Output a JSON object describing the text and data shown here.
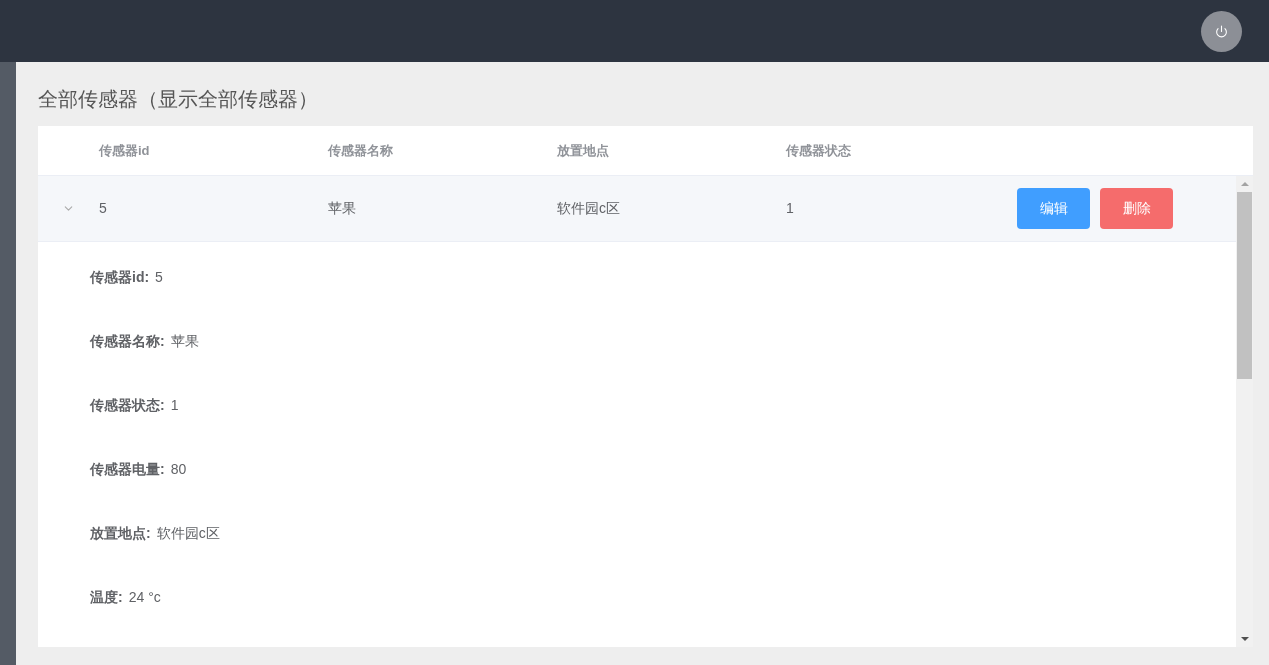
{
  "page_title": "全部传感器（显示全部传感器）",
  "table": {
    "columns": [
      "传感器id",
      "传感器名称",
      "放置地点",
      "传感器状态"
    ],
    "rows": [
      {
        "expanded": true,
        "cells": [
          "5",
          "苹果",
          "软件园c区",
          "1"
        ],
        "actions": [
          {
            "kind": "primary",
            "label": "编辑"
          },
          {
            "kind": "danger",
            "label": "删除"
          }
        ],
        "details": [
          {
            "label": "传感器id:",
            "value": "5"
          },
          {
            "label": "传感器名称:",
            "value": "苹果"
          },
          {
            "label": "传感器状态:",
            "value": "1"
          },
          {
            "label": "传感器电量:",
            "value": "80"
          },
          {
            "label": "放置地点:",
            "value": "软件园c区"
          },
          {
            "label": "温度:",
            "value": "24 °c"
          }
        ]
      }
    ]
  }
}
